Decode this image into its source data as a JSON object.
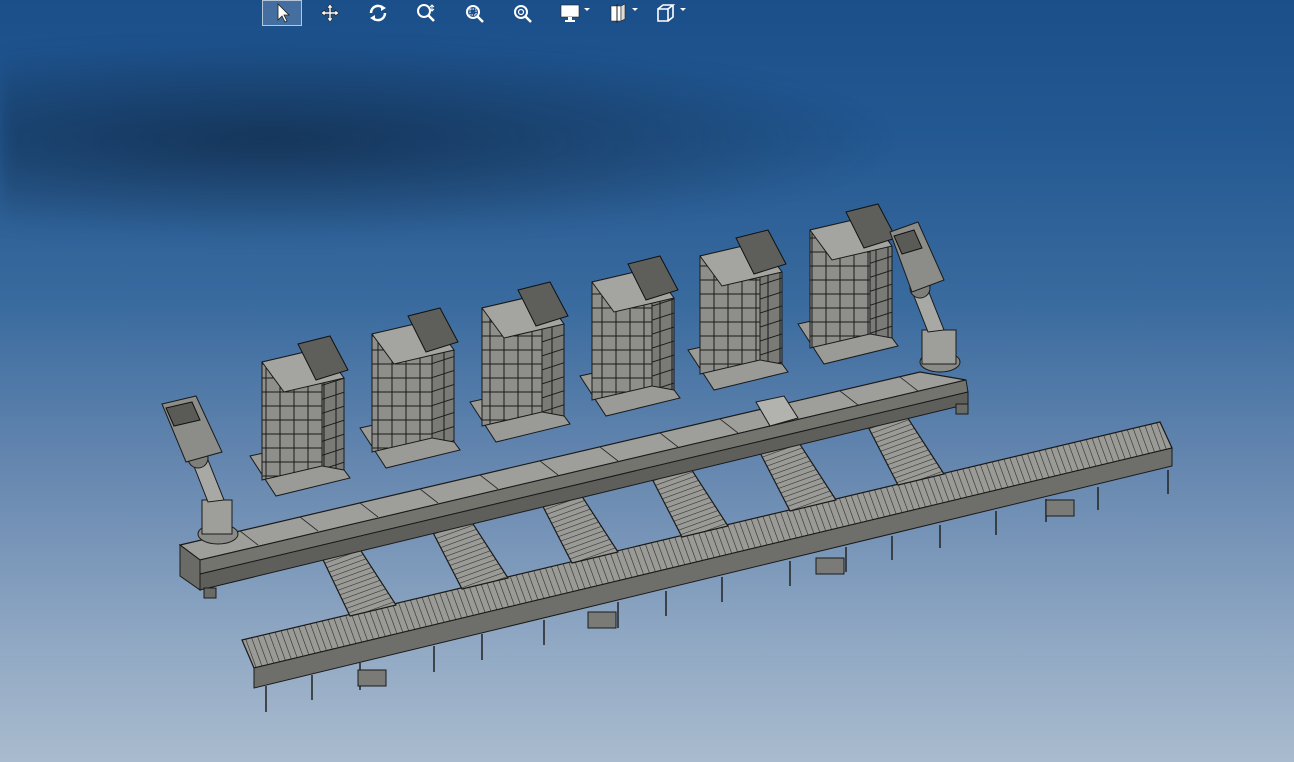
{
  "toolbar": {
    "tools": [
      {
        "icon": "select-arrow-icon",
        "active": true,
        "dropdown": false
      },
      {
        "icon": "pan-icon",
        "active": false,
        "dropdown": false
      },
      {
        "icon": "rotate-icon",
        "active": false,
        "dropdown": false
      },
      {
        "icon": "zoom-icon",
        "active": false,
        "dropdown": false
      },
      {
        "icon": "zoom-window-icon",
        "active": false,
        "dropdown": false
      },
      {
        "icon": "zoom-fit-icon",
        "active": false,
        "dropdown": false
      },
      {
        "icon": "display-style-icon",
        "active": false,
        "dropdown": true
      },
      {
        "icon": "section-view-icon",
        "active": false,
        "dropdown": true
      },
      {
        "icon": "view-orientation-icon",
        "active": false,
        "dropdown": true
      }
    ]
  },
  "colors": {
    "background_top": "#1b4f8a",
    "background_bottom": "#a9bbce",
    "model_fill": "#8a8a86",
    "model_edge": "#1a1a1a",
    "toolbar_icon": "#ffffff"
  },
  "scene": {
    "palletizing_cells": 6,
    "robot_arms": 2,
    "conveyor_lanes": 6
  }
}
